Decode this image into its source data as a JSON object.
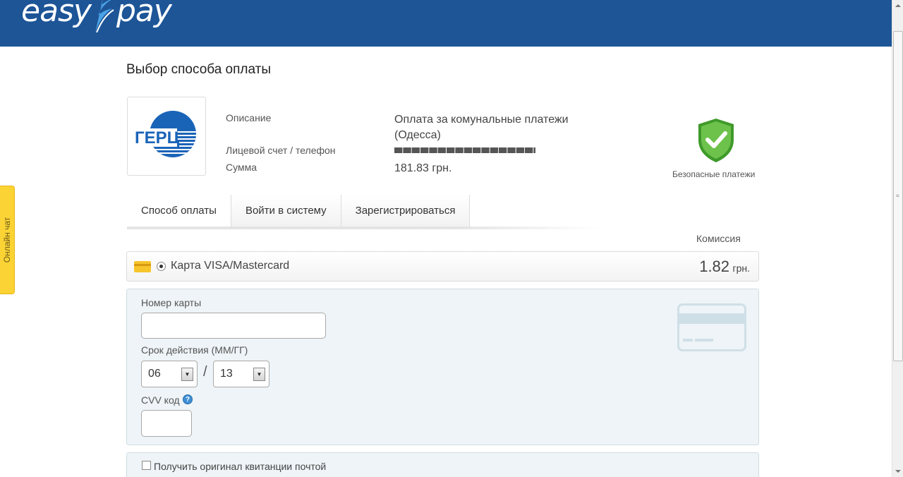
{
  "header": {
    "logo_left": "easy",
    "logo_right": "pay"
  },
  "page": {
    "title": "Выбор способа оплаты"
  },
  "merchant": {
    "logo_text": "ГЕРЦ"
  },
  "payment_info": {
    "description_label": "Описание",
    "description_value": "Оплата за комунальные платежи (Одесса)",
    "account_label": "Лицевой счет / телефон",
    "account_value": "█████████████████",
    "amount_label": "Сумма",
    "amount_value": "181.83 грн."
  },
  "security": {
    "label": "Безопасные платежи"
  },
  "tabs": [
    {
      "label": "Способ оплаты",
      "active": true
    },
    {
      "label": "Войти в систему",
      "active": false
    },
    {
      "label": "Зарегистрироваться",
      "active": false
    }
  ],
  "commission": {
    "header": "Комиссия"
  },
  "method": {
    "label": "Карта VISA/Mastercard",
    "fee_value": "1.82",
    "fee_currency": "грн.",
    "selected": true
  },
  "card_form": {
    "card_number_label": "Номер карты",
    "card_number_value": "",
    "expiry_label": "Срок действия (ММ/ГГ)",
    "expiry_month": "06",
    "expiry_year": "13",
    "separator": "/",
    "cvv_label": "CVV код",
    "cvv_value": ""
  },
  "receipt": {
    "label": "Получить оригинал квитанции почтой",
    "checked": false
  },
  "chat": {
    "label": "Онлайн чат"
  },
  "colors": {
    "header_bg": "#1d5597",
    "chat_tab_bg": "#fbd334",
    "form_bg": "#eef4f7",
    "shield_green": "#5bb33a",
    "merchant_blue": "#1a64b8"
  }
}
